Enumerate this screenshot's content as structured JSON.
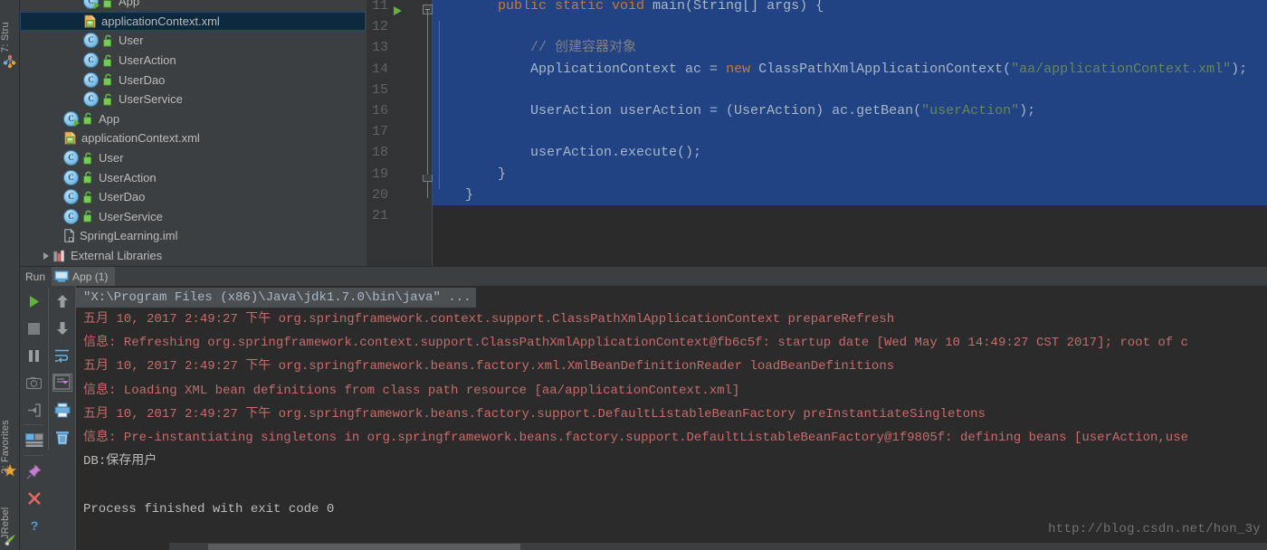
{
  "window": {
    "theme_bg": "#3c3f41",
    "editor_bg": "#2b2b2b",
    "selection_color": "#214283",
    "accent_green": "#5fb336",
    "stderr_color": "#c76b6b"
  },
  "left_strip": {
    "structure_label": "7: Stru",
    "favorites_label": "2: Favorites",
    "jrebel_label": "JRebel"
  },
  "project_tree": {
    "rows": [
      {
        "indent": 2,
        "icon": "class-runnable-icon",
        "lock": true,
        "label": "App"
      },
      {
        "indent": 2,
        "icon": "xml-file-icon",
        "lock": false,
        "label": "applicationContext.xml",
        "selected": true
      },
      {
        "indent": 2,
        "icon": "class-icon",
        "lock": true,
        "label": "User"
      },
      {
        "indent": 2,
        "icon": "class-icon",
        "lock": true,
        "label": "UserAction"
      },
      {
        "indent": 2,
        "icon": "class-icon",
        "lock": true,
        "label": "UserDao"
      },
      {
        "indent": 2,
        "icon": "class-icon",
        "lock": true,
        "label": "UserService"
      },
      {
        "indent": 1,
        "icon": "class-runnable-icon",
        "lock": true,
        "label": "App"
      },
      {
        "indent": 1,
        "icon": "xml-file-icon",
        "lock": false,
        "label": "applicationContext.xml"
      },
      {
        "indent": 1,
        "icon": "class-icon",
        "lock": true,
        "label": "User"
      },
      {
        "indent": 1,
        "icon": "class-icon",
        "lock": true,
        "label": "UserAction"
      },
      {
        "indent": 1,
        "icon": "class-icon",
        "lock": true,
        "label": "UserDao"
      },
      {
        "indent": 1,
        "icon": "class-icon",
        "lock": true,
        "label": "UserService"
      },
      {
        "indent": 1,
        "icon": "iml-file-icon",
        "lock": false,
        "label": "SpringLearning.iml"
      },
      {
        "indent": 0,
        "icon": "library-icon",
        "lock": false,
        "label": "External Libraries",
        "expander": true
      }
    ]
  },
  "editor": {
    "line_numbers": [
      "11",
      "12",
      "13",
      "14",
      "15",
      "16",
      "17",
      "18",
      "19",
      "20",
      "21"
    ],
    "lines": [
      {
        "num": "11",
        "selected": true,
        "tokens": [
          {
            "t": "        ",
            "c": "txt"
          },
          {
            "t": "public static void ",
            "c": "key"
          },
          {
            "t": "main(String[] args) {",
            "c": "txt"
          }
        ]
      },
      {
        "num": "12",
        "selected": true,
        "tokens": [
          {
            "t": "",
            "c": "txt"
          }
        ]
      },
      {
        "num": "13",
        "selected": true,
        "tokens": [
          {
            "t": "            ",
            "c": "txt"
          },
          {
            "t": "// 创建容器对象",
            "c": "cmt"
          }
        ]
      },
      {
        "num": "14",
        "selected": true,
        "tokens": [
          {
            "t": "            ApplicationContext ac = ",
            "c": "txt"
          },
          {
            "t": "new ",
            "c": "key"
          },
          {
            "t": "ClassPathXmlApplicationContext(",
            "c": "txt"
          },
          {
            "t": "\"aa/applicationContext.xml\"",
            "c": "str"
          },
          {
            "t": ");",
            "c": "txt"
          }
        ]
      },
      {
        "num": "15",
        "selected": true,
        "tokens": [
          {
            "t": "",
            "c": "txt"
          }
        ]
      },
      {
        "num": "16",
        "selected": true,
        "tokens": [
          {
            "t": "            UserAction userAction = (UserAction) ac.getBean(",
            "c": "txt"
          },
          {
            "t": "\"userAction\"",
            "c": "str"
          },
          {
            "t": ");",
            "c": "txt"
          }
        ]
      },
      {
        "num": "17",
        "selected": true,
        "tokens": [
          {
            "t": "",
            "c": "txt"
          }
        ]
      },
      {
        "num": "18",
        "selected": true,
        "tokens": [
          {
            "t": "            userAction.execute();",
            "c": "txt"
          }
        ]
      },
      {
        "num": "19",
        "selected": true,
        "tokens": [
          {
            "t": "        }",
            "c": "txt"
          }
        ]
      },
      {
        "num": "20",
        "selected": true,
        "tokens": [
          {
            "t": "    }",
            "c": "txt"
          }
        ]
      },
      {
        "num": "21",
        "selected": false,
        "tokens": [
          {
            "t": "",
            "c": "txt"
          }
        ]
      }
    ]
  },
  "run_window": {
    "title": "Run",
    "tab_label": "App (1)",
    "toolbar_buttons_col1": [
      "rerun-button",
      "stop-button",
      "pause-button",
      "camera-button",
      "export-button",
      "layout-button",
      "pin-button",
      "close-button",
      "help-button"
    ],
    "toolbar_buttons_col2": [
      "scroll-up-button",
      "scroll-down-button",
      "soft-wrap-button",
      "scroll-to-end-button",
      "print-button",
      "clear-all-button"
    ],
    "console_lines": [
      {
        "type": "cmd",
        "text": "\"X:\\Program Files (x86)\\Java\\jdk1.7.0\\bin\\java\" ..."
      },
      {
        "type": "err",
        "text": "五月 10, 2017 2:49:27 下午 org.springframework.context.support.ClassPathXmlApplicationContext prepareRefresh"
      },
      {
        "type": "err",
        "text": "信息: Refreshing org.springframework.context.support.ClassPathXmlApplicationContext@fb6c5f: startup date [Wed May 10 14:49:27 CST 2017]; root of c"
      },
      {
        "type": "err",
        "text": "五月 10, 2017 2:49:27 下午 org.springframework.beans.factory.xml.XmlBeanDefinitionReader loadBeanDefinitions"
      },
      {
        "type": "err",
        "text": "信息: Loading XML bean definitions from class path resource [aa/applicationContext.xml]"
      },
      {
        "type": "err",
        "text": "五月 10, 2017 2:49:27 下午 org.springframework.beans.factory.support.DefaultListableBeanFactory preInstantiateSingletons"
      },
      {
        "type": "err",
        "text": "信息: Pre-instantiating singletons in org.springframework.beans.factory.support.DefaultListableBeanFactory@1f9805f: defining beans [userAction,use"
      },
      {
        "type": "out",
        "text": "DB:保存用户"
      },
      {
        "type": "out",
        "text": ""
      },
      {
        "type": "out",
        "text": "Process finished with exit code 0"
      }
    ]
  },
  "watermark": {
    "text": "http://blog.csdn.net/hon_3y"
  }
}
